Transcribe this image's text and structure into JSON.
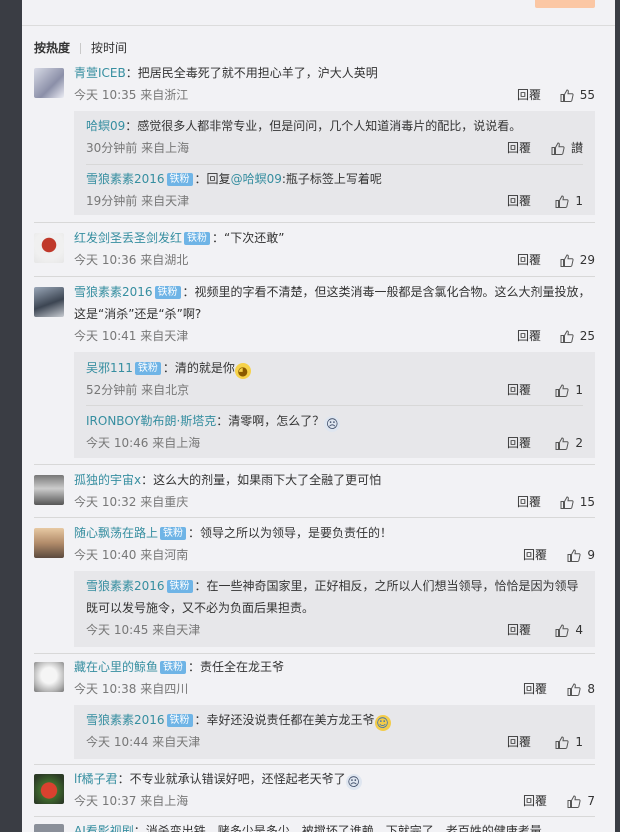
{
  "sort": {
    "hot": "按热度",
    "time": "按时间"
  },
  "reply_label": "回覆",
  "colors": {
    "username": "#368ea0",
    "badge": "#6fb4e6",
    "submit": "#fbc7a4"
  },
  "comments": [
    {
      "user": "青萱ICEB",
      "text": "：把居民全毒死了就不用担心羊了，沪大人英明",
      "time": "今天 10:35 来自浙江",
      "likes": "55",
      "replies": [
        {
          "user": "哈螟09",
          "text": "：感觉很多人都非常专业，但是问问，几个人知道消毒片的配比，说说看。",
          "time": "30分钟前 来自上海",
          "likes": "讃"
        },
        {
          "user": "雪狼素素2016",
          "badge": "铁粉",
          "prefix": "：回复",
          "mention": "@哈螟09",
          "text": ":瓶子标签上写着呢",
          "time": "19分钟前 来自天津",
          "likes": "1"
        }
      ]
    },
    {
      "user": "红发剑圣丢圣剑发红",
      "badge": "铁粉",
      "text": "：“下次还敢”",
      "time": "今天 10:36 来自湖北",
      "likes": "29"
    },
    {
      "user": "雪狼素素2016",
      "badge": "铁粉",
      "text": "：视频里的字看不清楚，但这类消毒一般都是含氯化合物。这么大剂量投放，",
      "text2": "这是“消杀”还是“杀”啊?",
      "time": "今天 10:41 来自天津",
      "likes": "25",
      "replies": [
        {
          "user": "吴邪111",
          "badge": "铁粉",
          "text": "：清的就是你",
          "time": "52分钟前 来自北京",
          "likes": "1"
        },
        {
          "user": "IRONBOY勒布朗·斯塔克",
          "text": "：清零啊，怎么了？",
          "time": "今天 10:46 来自上海",
          "likes": "2"
        }
      ]
    },
    {
      "user": "孤独的宇宙x",
      "text": "：这么大的剂量，如果雨下大了全融了更可怕",
      "time": "今天 10:32 来自重庆",
      "likes": "15"
    },
    {
      "user": "随心飘荡在路上",
      "badge": "铁粉",
      "text": "：领导之所以为领导，是要负责任的！",
      "time": "今天 10:40 来自河南",
      "likes": "9",
      "replies": [
        {
          "user": "雪狼素素2016",
          "badge": "铁粉",
          "text": "：在一些神奇国家里，正好相反，之所以人们想当领导，恰恰是因为领导",
          "text2": "既可以发号施令，又不必为负面后果担责。",
          "time": "今天 10:45 来自天津",
          "likes": "4"
        }
      ]
    },
    {
      "user": "藏在心里的鲸鱼",
      "badge": "铁粉",
      "text": "：责任全在龙王爷",
      "time": "今天 10:38 来自四川",
      "likes": "8",
      "replies": [
        {
          "user": "雪狼素素2016",
          "badge": "铁粉",
          "text": "：幸好还没说责任都在美方龙王爷",
          "time": "今天 10:44 来自天津",
          "likes": "1"
        }
      ]
    },
    {
      "user": "lf橘子君",
      "text": "：不专业就承认错误好吧，还怪起老天爷了",
      "time": "今天 10:37 来自上海",
      "likes": "7"
    },
    {
      "user": "AI看影视剧",
      "text": "：消杀变出铁，赌多少是多少，被搅坏了谁赖，下就完了，老百姓的健康考量",
      "time": "",
      "likes": ""
    }
  ]
}
